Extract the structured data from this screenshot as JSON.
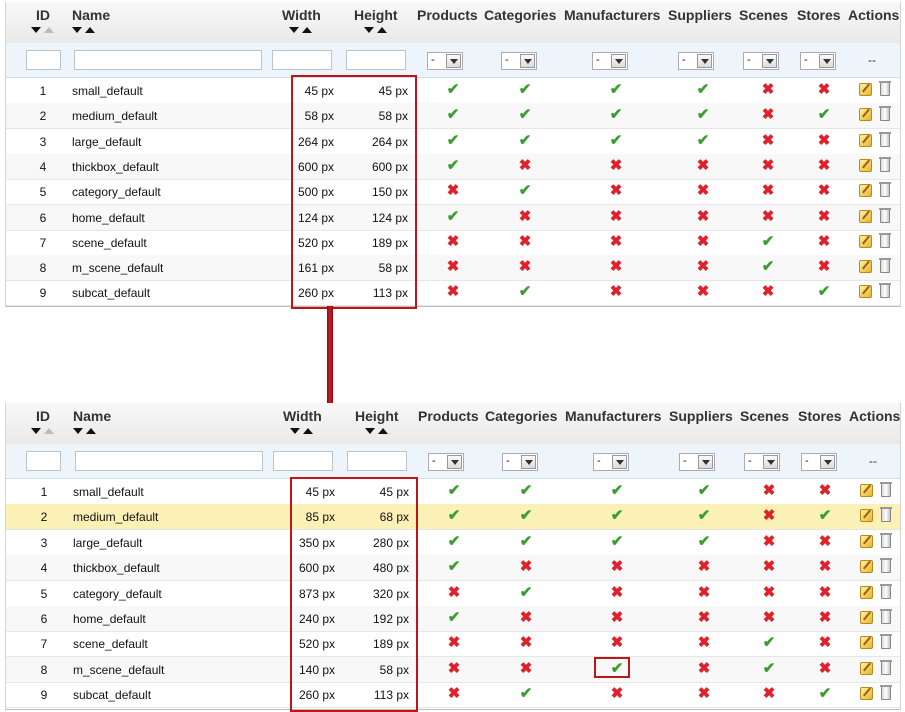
{
  "columns": {
    "id": "ID",
    "name": "Name",
    "width": "Width",
    "height": "Height",
    "products": "Products",
    "categories": "Categories",
    "manufacturers": "Manufacturers",
    "suppliers": "Suppliers",
    "scenes": "Scenes",
    "stores": "Stores",
    "actions": "Actions"
  },
  "filters": {
    "select_value": "-",
    "actions_placeholder": "--"
  },
  "icons": {
    "check": "✔",
    "cross": "✖"
  },
  "colors": {
    "check": "#3a9d2f",
    "cross": "#e0202a",
    "highlight_row": "#fbf0b5",
    "annotation": "#c0141b"
  },
  "top_table": {
    "rows": [
      {
        "id": "1",
        "name": "small_default",
        "width": "45 px",
        "height": "45 px",
        "products": true,
        "categories": true,
        "manufacturers": true,
        "suppliers": true,
        "scenes": false,
        "stores": false
      },
      {
        "id": "2",
        "name": "medium_default",
        "width": "58 px",
        "height": "58 px",
        "products": true,
        "categories": true,
        "manufacturers": true,
        "suppliers": true,
        "scenes": false,
        "stores": true
      },
      {
        "id": "3",
        "name": "large_default",
        "width": "264 px",
        "height": "264 px",
        "products": true,
        "categories": true,
        "manufacturers": true,
        "suppliers": true,
        "scenes": false,
        "stores": false
      },
      {
        "id": "4",
        "name": "thickbox_default",
        "width": "600 px",
        "height": "600 px",
        "products": true,
        "categories": false,
        "manufacturers": false,
        "suppliers": false,
        "scenes": false,
        "stores": false
      },
      {
        "id": "5",
        "name": "category_default",
        "width": "500 px",
        "height": "150 px",
        "products": false,
        "categories": true,
        "manufacturers": false,
        "suppliers": false,
        "scenes": false,
        "stores": false
      },
      {
        "id": "6",
        "name": "home_default",
        "width": "124 px",
        "height": "124 px",
        "products": true,
        "categories": false,
        "manufacturers": false,
        "suppliers": false,
        "scenes": false,
        "stores": false
      },
      {
        "id": "7",
        "name": "scene_default",
        "width": "520 px",
        "height": "189 px",
        "products": false,
        "categories": false,
        "manufacturers": false,
        "suppliers": false,
        "scenes": true,
        "stores": false
      },
      {
        "id": "8",
        "name": "m_scene_default",
        "width": "161 px",
        "height": "58 px",
        "products": false,
        "categories": false,
        "manufacturers": false,
        "suppliers": false,
        "scenes": true,
        "stores": false
      },
      {
        "id": "9",
        "name": "subcat_default",
        "width": "260 px",
        "height": "113 px",
        "products": false,
        "categories": true,
        "manufacturers": false,
        "suppliers": false,
        "scenes": false,
        "stores": true
      }
    ]
  },
  "bottom_table": {
    "highlighted_row_id": "2",
    "rows": [
      {
        "id": "1",
        "name": "small_default",
        "width": "45 px",
        "height": "45 px",
        "products": true,
        "categories": true,
        "manufacturers": true,
        "suppliers": true,
        "scenes": false,
        "stores": false
      },
      {
        "id": "2",
        "name": "medium_default",
        "width": "85 px",
        "height": "68 px",
        "products": true,
        "categories": true,
        "manufacturers": true,
        "suppliers": true,
        "scenes": false,
        "stores": true
      },
      {
        "id": "3",
        "name": "large_default",
        "width": "350 px",
        "height": "280 px",
        "products": true,
        "categories": true,
        "manufacturers": true,
        "suppliers": true,
        "scenes": false,
        "stores": false
      },
      {
        "id": "4",
        "name": "thickbox_default",
        "width": "600 px",
        "height": "480 px",
        "products": true,
        "categories": false,
        "manufacturers": false,
        "suppliers": false,
        "scenes": false,
        "stores": false
      },
      {
        "id": "5",
        "name": "category_default",
        "width": "873 px",
        "height": "320 px",
        "products": false,
        "categories": true,
        "manufacturers": false,
        "suppliers": false,
        "scenes": false,
        "stores": false
      },
      {
        "id": "6",
        "name": "home_default",
        "width": "240 px",
        "height": "192 px",
        "products": true,
        "categories": false,
        "manufacturers": false,
        "suppliers": false,
        "scenes": false,
        "stores": false
      },
      {
        "id": "7",
        "name": "scene_default",
        "width": "520 px",
        "height": "189 px",
        "products": false,
        "categories": false,
        "manufacturers": false,
        "suppliers": false,
        "scenes": true,
        "stores": false
      },
      {
        "id": "8",
        "name": "m_scene_default",
        "width": "140 px",
        "height": "58 px",
        "products": false,
        "categories": false,
        "manufacturers": true,
        "suppliers": false,
        "scenes": true,
        "stores": false
      },
      {
        "id": "9",
        "name": "subcat_default",
        "width": "260 px",
        "height": "113 px",
        "products": false,
        "categories": true,
        "manufacturers": false,
        "suppliers": false,
        "scenes": false,
        "stores": true
      }
    ]
  }
}
